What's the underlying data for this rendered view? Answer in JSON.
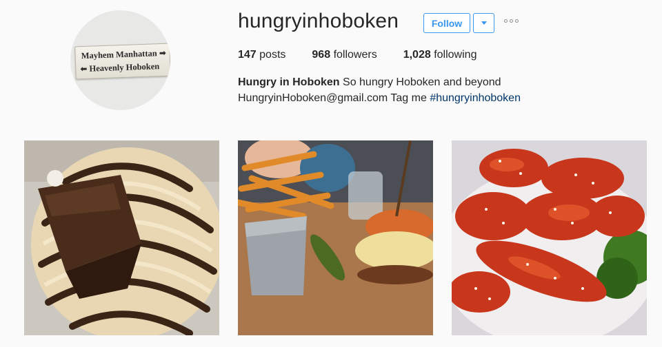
{
  "profile": {
    "avatar_sign": {
      "line1": "Mayhem Manhattan",
      "line2": "Heavenly Hoboken",
      "arrow_right": "➡",
      "arrow_left": "⬅"
    },
    "username": "hungryinhoboken",
    "follow_label": "Follow",
    "stats": {
      "posts_count": "147",
      "posts_label": "posts",
      "followers_count": "968",
      "followers_label": "followers",
      "following_count": "1,028",
      "following_label": "following"
    },
    "bio": {
      "name": "Hungry in Hoboken",
      "tagline": "So hungry Hoboken and beyond",
      "email": "HungryinHoboken@gmail.com",
      "tag_text": "Tag me",
      "hashtag": "#hungryinhoboken"
    }
  },
  "posts": [
    {
      "icon": "cupcake-photo"
    },
    {
      "icon": "burger-fries-photo"
    },
    {
      "icon": "sesame-chicken-photo"
    }
  ],
  "colors": {
    "accent": "#3897f0",
    "text": "#262626",
    "hashtag": "#003569",
    "background": "#fafafa"
  }
}
